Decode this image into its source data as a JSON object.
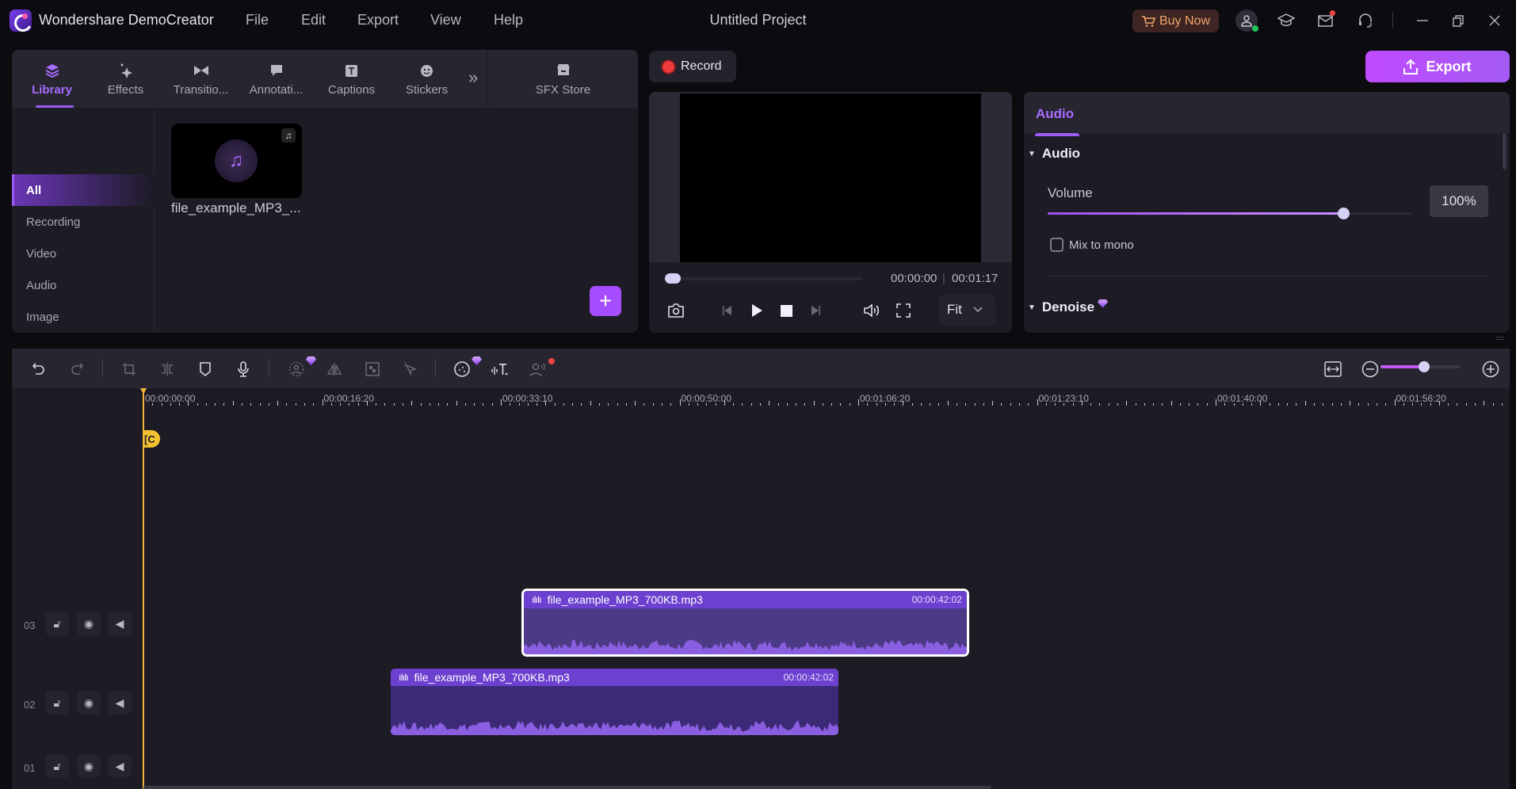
{
  "app": {
    "name": "Wondershare DemoCreator",
    "project_title": "Untitled Project",
    "menu": [
      "File",
      "Edit",
      "Export",
      "View",
      "Help"
    ],
    "buy_now_label": "Buy Now",
    "colors": {
      "accent": "#9a5cf5",
      "export": "#c04bff",
      "buy_now_text": "#f2a66a",
      "record": "#ef3b3b",
      "playhead": "#f0b43a"
    }
  },
  "library": {
    "tabs": [
      {
        "label": "Library",
        "icon": "layers-icon",
        "active": true
      },
      {
        "label": "Effects",
        "icon": "sparkles-icon"
      },
      {
        "label": "Transitio...",
        "icon": "transition-icon"
      },
      {
        "label": "Annotati...",
        "icon": "annotation-icon"
      },
      {
        "label": "Captions",
        "icon": "captions-icon"
      },
      {
        "label": "Stickers",
        "icon": "sticker-icon"
      }
    ],
    "sfx_store_label": "SFX Store",
    "categories": [
      {
        "label": "All",
        "active": true
      },
      {
        "label": "Recording"
      },
      {
        "label": "Video"
      },
      {
        "label": "Audio"
      },
      {
        "label": "Image"
      }
    ],
    "media": [
      {
        "name": "file_example_MP3_...",
        "type": "audio"
      }
    ]
  },
  "record": {
    "label": "Record"
  },
  "preview": {
    "current_time": "00:00:00",
    "total_time": "00:01:17",
    "progress_fraction": 0,
    "fit_label": "Fit"
  },
  "export": {
    "label": "Export"
  },
  "properties": {
    "tab_label": "Audio",
    "sections": {
      "audio": {
        "title": "Audio",
        "volume_label": "Volume",
        "volume_value": "100%",
        "volume_fraction": 0.81,
        "mix_to_mono_label": "Mix to mono",
        "mix_to_mono_checked": false
      },
      "denoise": {
        "title": "Denoise",
        "premium": true
      }
    }
  },
  "timeline": {
    "zoom_fraction": 0.55,
    "ruler_labels": [
      "00:00:00:00",
      "00:00:16:20",
      "00:00:33:10",
      "00:00:50:00",
      "00:01:06:20",
      "00:01:23:10",
      "00:01:40:00",
      "00:01:56:20"
    ],
    "tracks": [
      {
        "number": "03"
      },
      {
        "number": "02"
      },
      {
        "number": "01"
      }
    ],
    "clips": [
      {
        "track": "03",
        "name": "file_example_MP3_700KB.mp3",
        "duration": "00:00:42:02",
        "selected": true
      },
      {
        "track": "02",
        "name": "file_example_MP3_700KB.mp3",
        "duration": "00:00:42:02",
        "selected": false
      }
    ]
  }
}
